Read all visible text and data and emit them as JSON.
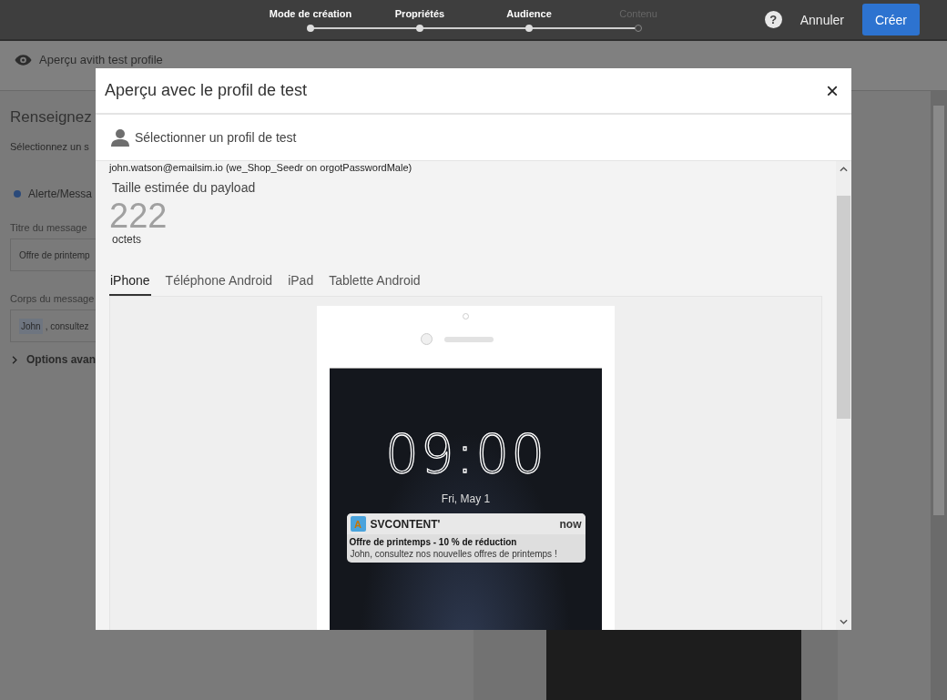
{
  "topbar": {
    "steps": [
      {
        "label": "Mode de création",
        "done": true
      },
      {
        "label": "Propriétés",
        "done": true
      },
      {
        "label": "Audience",
        "done": true
      },
      {
        "label": "Contenu",
        "done": false
      }
    ],
    "help": "?",
    "cancel": "Annuler",
    "create": "Créer"
  },
  "background": {
    "header": "Aperçu avith test profile",
    "section_title": "Renseignez",
    "intro": "Sélectionnez un s",
    "style_option": {
      "label": "Alerte/Messa",
      "selected": true
    },
    "title_label": "Titre du message",
    "title_value": "Offre de printemp",
    "body_label": "Corps du message",
    "body_token": "John",
    "body_value": ", consultez",
    "advanced": "Options avan"
  },
  "modal": {
    "title": "Aperçu avec le profil de test",
    "close": "×",
    "profile_button": "Sélectionner un profil de test",
    "profile_line": "john.watson@emailsim.io (we_Shop_Seedr on orgotPasswordMale)",
    "payload_label": "Taille estimée du payload",
    "payload_value": "222",
    "payload_unit": "octets",
    "tabs": [
      {
        "label": "iPhone",
        "selected": true
      },
      {
        "label": "Téléphone Android",
        "selected": false
      },
      {
        "label": "iPad",
        "selected": false
      },
      {
        "label": "Tablette Android",
        "selected": false
      }
    ],
    "phone": {
      "time": "09:00",
      "date": "Fri, May 1",
      "notification": {
        "app_icon": "A",
        "app": "SVCONTENT'",
        "when": "now",
        "title": "Offre de printemps - 10 % de réduction",
        "body": "John, consultez nos nouvelles offres de printemps !"
      }
    }
  }
}
